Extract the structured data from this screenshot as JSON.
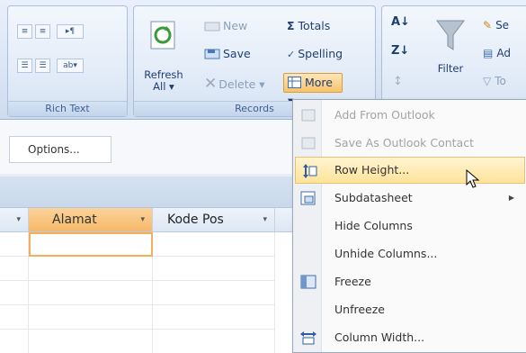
{
  "ribbon": {
    "rich_text_label": "Rich Text",
    "records_label": "Records",
    "refresh_label_1": "Refresh",
    "refresh_label_2": "All",
    "new_label": "New",
    "save_label": "Save",
    "delete_label": "Delete",
    "totals_label": "Totals",
    "spelling_label": "Spelling",
    "more_label": "More",
    "filter_label": "Filter",
    "sort_partial_1": "Se",
    "sort_partial_2": "Ad",
    "sort_partial_3": "To"
  },
  "options_button": "Options...",
  "grid": {
    "columns": [
      "Alamat",
      "Kode Pos"
    ]
  },
  "menu": {
    "items": [
      {
        "label": "Add From Outlook",
        "enabled": false
      },
      {
        "label": "Save As Outlook Contact",
        "enabled": false
      },
      {
        "label": "Row Height...",
        "enabled": true,
        "highlighted": true
      },
      {
        "label": "Subdatasheet",
        "enabled": true,
        "submenu": true
      },
      {
        "label": "Hide Columns",
        "enabled": true
      },
      {
        "label": "Unhide Columns...",
        "enabled": true
      },
      {
        "label": "Freeze",
        "enabled": true
      },
      {
        "label": "Unfreeze",
        "enabled": true
      },
      {
        "label": "Column Width...",
        "enabled": true
      }
    ]
  },
  "colors": {
    "highlight": "#ffe39a",
    "active_header": "#f7b968",
    "ribbon": "#dbe6f5"
  },
  "icons": [
    "indent-icon",
    "outdent-icon",
    "list-icon",
    "refresh-icon",
    "new-record-icon",
    "save-icon",
    "delete-icon",
    "sigma-icon",
    "spelling-icon",
    "more-icon",
    "sort-icon",
    "filter-icon",
    "mouse-cursor-icon"
  ]
}
